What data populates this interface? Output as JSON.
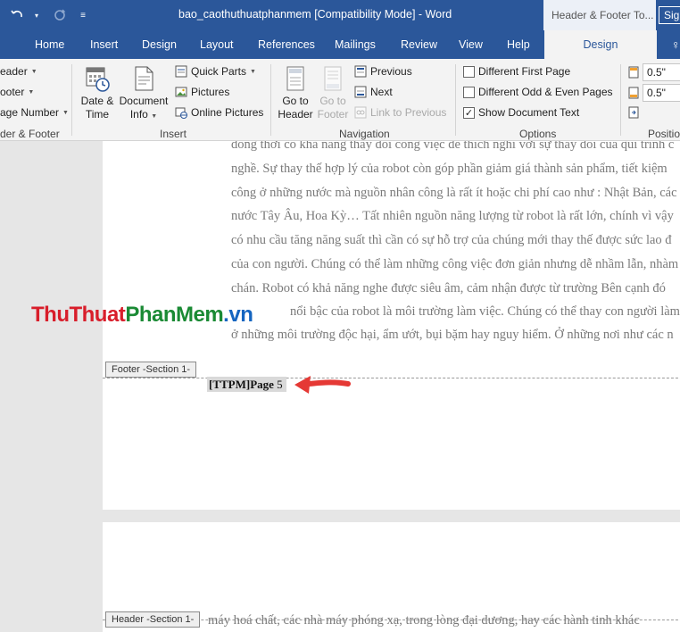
{
  "titlebar": {
    "doc_title": "bao_caothuthuatphanmem [Compatibility Mode] - Word",
    "context_title": "Header & Footer To...",
    "signin": "Sig"
  },
  "tabs": [
    "Home",
    "Insert",
    "Design",
    "Layout",
    "References",
    "Mailings",
    "Review",
    "View",
    "Help",
    "Design"
  ],
  "active_tab_index": 9,
  "ribbon": {
    "header_footer_group": {
      "items": [
        "eader",
        "ooter",
        "age Number"
      ],
      "label": "der & Footer"
    },
    "insert_group": {
      "date_time": [
        "Date &",
        "Time"
      ],
      "document_info": [
        "Document",
        "Info"
      ],
      "quick_parts": "Quick Parts",
      "pictures": "Pictures",
      "online_pictures": "Online Pictures",
      "label": "Insert"
    },
    "navigation_group": {
      "go_to_header": [
        "Go to",
        "Header"
      ],
      "go_to_footer": [
        "Go to",
        "Footer"
      ],
      "previous": "Previous",
      "next": "Next",
      "link_to_previous": "Link to Previous",
      "label": "Navigation"
    },
    "options_group": {
      "different_first_page": "Different First Page",
      "different_odd_even": "Different Odd & Even Pages",
      "show_document_text": "Show Document Text",
      "different_first_page_checked": false,
      "different_odd_even_checked": false,
      "show_document_text_checked": true,
      "label": "Options"
    },
    "position_group": {
      "header_from_top": "0.5\"",
      "footer_from_bottom": "0.5\"",
      "label": "Positio"
    }
  },
  "document": {
    "body_lines": [
      "đồng thời có khả năng thay đổi công việc để thích nghi với sự thay đổi của qui trình c",
      "nghề. Sự thay thế hợp lý của robot còn góp phần giảm giá thành sản phẩm, tiết kiệm",
      "công ở những nước mà nguồn nhân công là rất ít hoặc chi phí cao như : Nhật Bản, các",
      "nước Tây Âu, Hoa Kỳ… Tất nhiên nguồn năng lượng từ robot là rất lớn, chính vì vậy",
      "có nhu cầu tăng năng suất thì cần có sự hỗ trợ của chúng mới thay thế được sức lao đ",
      "của con người. Chúng có thể làm những công việc đơn giản nhưng dễ nhầm lẫn, nhàm",
      "chán. Robot có khả năng nghe được siêu âm, cảm nhận được từ trường Bên cạnh đó",
      "nổi bậc của robot là môi trường làm việc. Chúng có thể thay con người làm v",
      "ở những môi trường độc hại, ẩm ướt, bụi bặm hay nguy hiểm. Ở những nơi như các n"
    ],
    "footer_section_label": "Footer -Section 1-",
    "footer_text": "[TTPM]Page ",
    "footer_page_field": "5",
    "header_section_label": "Header -Section 1-",
    "page2_line": "máy hoá chất, các nhà máy phóng xạ, trong lòng đại dương, hay các hành tinh khác"
  },
  "watermark": {
    "part1": "ThuThuat",
    "part2": "PhanMem",
    "part3": ".vn"
  },
  "colors": {
    "title_bar": "#2b579a",
    "arrow": "#e53935"
  }
}
